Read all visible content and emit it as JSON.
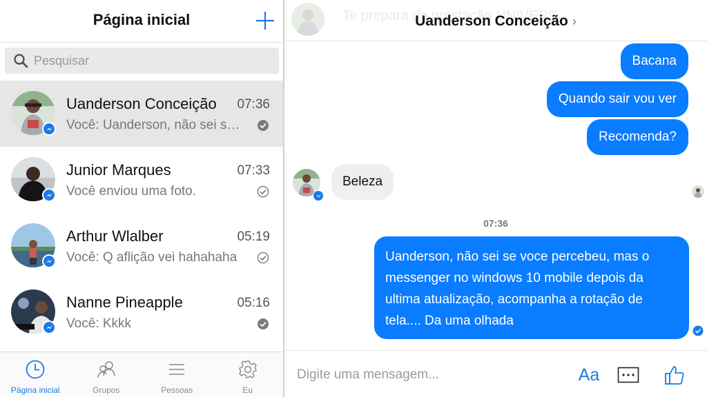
{
  "left_panel": {
    "title": "Página inicial",
    "add_label": "+",
    "search_placeholder": "Pesquisar",
    "conversations": [
      {
        "name": "Uanderson Conceição",
        "time": "07:36",
        "preview": "Você: Uanderson, não sei se voce percebeu",
        "status": "seen",
        "selected": true
      },
      {
        "name": "Junior Marques",
        "time": "07:33",
        "preview": "Você enviou uma foto.",
        "status": "delivered",
        "selected": false
      },
      {
        "name": "Arthur Wlalber",
        "time": "05:19",
        "preview": "Você: Q aflição vei hahahaha",
        "status": "delivered",
        "selected": false
      },
      {
        "name": "Nanne Pineapple",
        "time": "05:16",
        "preview": "Você: Kkkk",
        "status": "seen",
        "selected": false
      }
    ],
    "nav": [
      {
        "label": "Página inicial",
        "icon": "clock-icon",
        "active": true
      },
      {
        "label": "Grupos",
        "icon": "groups-icon",
        "active": false
      },
      {
        "label": "Pessoas",
        "icon": "list-icon",
        "active": false
      },
      {
        "label": "Eu",
        "icon": "gear-icon",
        "active": false
      }
    ]
  },
  "chat": {
    "title": "Uanderson Conceição",
    "title_chevron": "›",
    "background_banner": "Te prepara do prestação UNIVERS",
    "messages_out_top": [
      "Bacana",
      "Quando sair vou ver",
      "Recomenda?"
    ],
    "message_in": "Beleza",
    "timestamp": "07:36",
    "message_long": "Uanderson, não sei se voce percebeu, mas o messenger no windows 10 mobile depois da ultima atualização, acompanha a rotação de tela.... Da uma olhada",
    "composer_placeholder": "Digite uma mensagem...",
    "text_format_label": "Aa"
  },
  "colors": {
    "accent": "#1a7ae8",
    "bubble_outgoing": "#0a7cff",
    "bubble_incoming": "#efefef",
    "selected_row": "#e6e6e6"
  }
}
